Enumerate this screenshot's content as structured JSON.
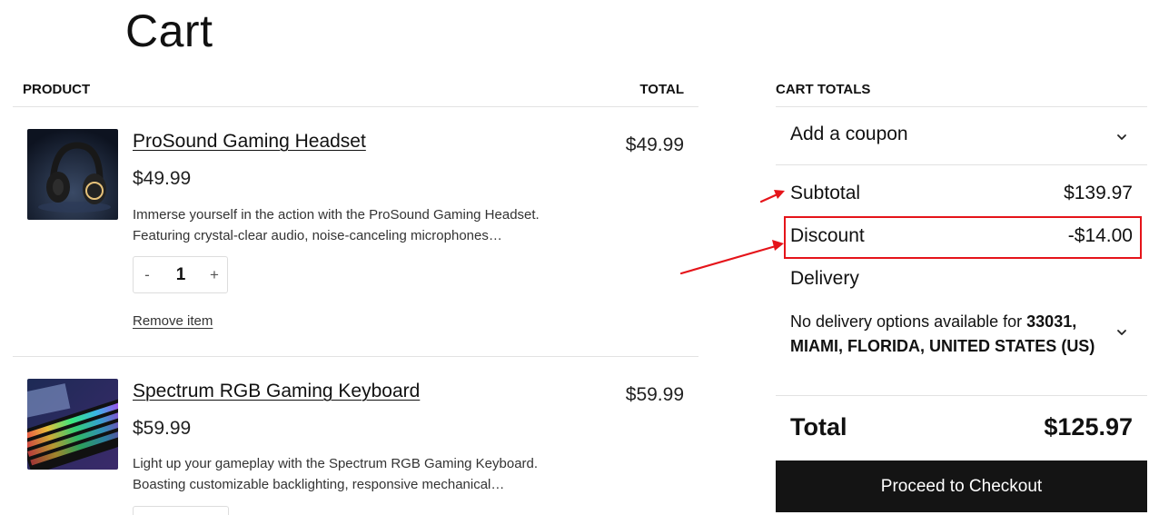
{
  "page_title": "Cart",
  "table": {
    "product_header": "PRODUCT",
    "total_header": "TOTAL"
  },
  "items": [
    {
      "name": "ProSound Gaming Headset",
      "price": "$49.99",
      "description_line1": "Immerse yourself in the action with the ProSound Gaming Headset.",
      "description_line2": "Featuring crystal-clear audio, noise-canceling microphones…",
      "quantity": "1",
      "total": "$49.99",
      "remove_label": "Remove item"
    },
    {
      "name": "Spectrum RGB Gaming Keyboard",
      "price": "$59.99",
      "description_line1": "Light up your gameplay with the Spectrum RGB Gaming Keyboard.",
      "description_line2": "Boasting customizable backlighting, responsive mechanical…",
      "total": "$59.99"
    }
  ],
  "qty_controls": {
    "minus": "-",
    "plus": "+"
  },
  "totals": {
    "header": "CART TOTALS",
    "coupon_label": "Add a coupon",
    "subtotal_label": "Subtotal",
    "subtotal_value": "$139.97",
    "discount_label": "Discount",
    "discount_value": "-$14.00",
    "delivery_label": "Delivery",
    "delivery_note_prefix": "No delivery options available for",
    "delivery_note_location_line1": "33031,",
    "delivery_note_location_line2": "MIAMI, FLORIDA, UNITED STATES (US)",
    "total_label": "Total",
    "total_value": "$125.97",
    "checkout_label": "Proceed to Checkout"
  },
  "icons": {
    "coupon_toggle": "chevron-down-icon",
    "delivery_toggle": "chevron-down-icon"
  },
  "colors": {
    "annotation_red": "#e5141a",
    "checkout_bg": "#141414"
  }
}
